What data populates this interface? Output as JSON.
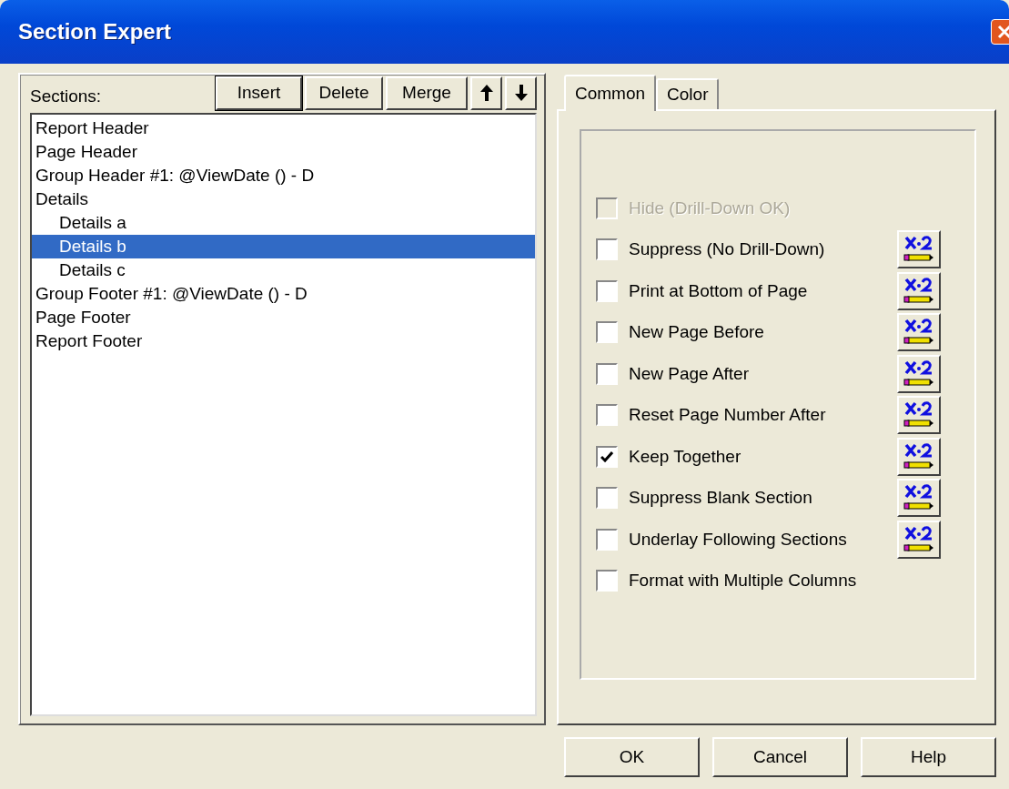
{
  "window": {
    "title": "Section Expert"
  },
  "sections": {
    "label": "Sections:",
    "buttons": [
      {
        "kind": "text",
        "label": "Insert",
        "selected": true
      },
      {
        "kind": "text",
        "label": "Delete",
        "selected": false
      },
      {
        "kind": "text",
        "label": "Merge",
        "selected": false
      },
      {
        "kind": "up",
        "selected": false
      },
      {
        "kind": "down",
        "selected": false
      }
    ],
    "items": [
      {
        "label": "Report Header",
        "selected": false
      },
      {
        "label": "Page Header",
        "selected": false
      },
      {
        "label": "Group Header #1: @ViewDate () - D",
        "selected": false
      },
      {
        "label": "Details",
        "selected": false,
        "children": [
          {
            "label": "Details a",
            "selected": false
          },
          {
            "label": "Details b",
            "selected": true
          },
          {
            "label": "Details c",
            "selected": false
          }
        ]
      },
      {
        "label": "Group Footer #1: @ViewDate () - D",
        "selected": false
      },
      {
        "label": "Page Footer",
        "selected": false
      },
      {
        "label": "Report Footer",
        "selected": false
      }
    ]
  },
  "tabs": [
    {
      "label": "Common",
      "selected": true
    },
    {
      "label": "Color",
      "selected": false
    }
  ],
  "options": [
    {
      "label": "Hide (Drill-Down OK)",
      "checked": false,
      "disabled": true,
      "formula": false
    },
    {
      "label": "Suppress (No Drill-Down)",
      "checked": false,
      "disabled": false,
      "formula": true
    },
    {
      "label": "Print at Bottom of Page",
      "checked": false,
      "disabled": false,
      "formula": true
    },
    {
      "label": "New Page Before",
      "checked": false,
      "disabled": false,
      "formula": true
    },
    {
      "label": "New Page After",
      "checked": false,
      "disabled": false,
      "formula": true
    },
    {
      "label": "Reset Page Number After",
      "checked": false,
      "disabled": false,
      "formula": true
    },
    {
      "label": "Keep Together",
      "checked": true,
      "disabled": false,
      "formula": true
    },
    {
      "label": "Suppress Blank Section",
      "checked": false,
      "disabled": false,
      "formula": true
    },
    {
      "label": "Underlay Following Sections",
      "checked": false,
      "disabled": false,
      "formula": true
    },
    {
      "label": "Format with Multiple Columns",
      "checked": false,
      "disabled": false,
      "formula": false
    }
  ],
  "buttons": [
    "OK",
    "Cancel",
    "Help"
  ]
}
